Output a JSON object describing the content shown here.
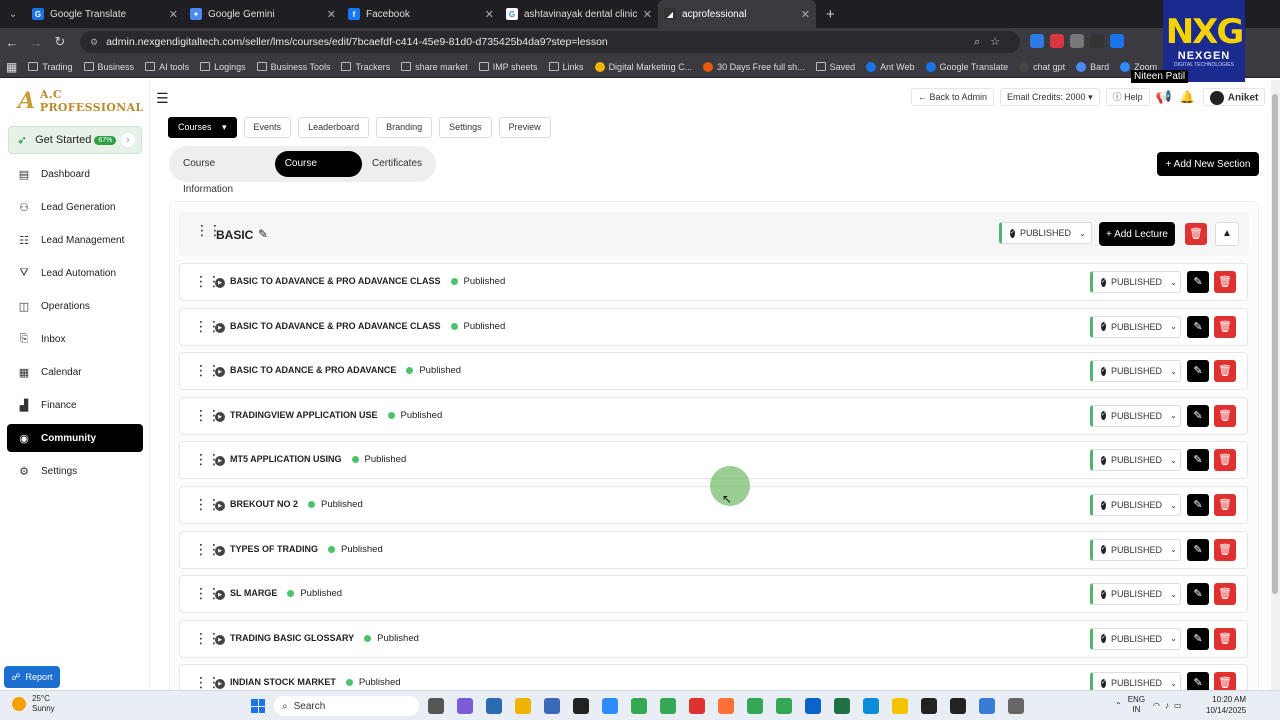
{
  "browser": {
    "tabs": [
      {
        "label": "Google Translate",
        "color": "#1a73e8",
        "glyph": "G"
      },
      {
        "label": "Google Gemini",
        "color": "#4a8af4",
        "glyph": "✦"
      },
      {
        "label": "Facebook",
        "color": "#1877f2",
        "glyph": "f"
      },
      {
        "label": "ashtavinayak dental clinic kolha",
        "color": "#ffffff",
        "glyph": "G"
      },
      {
        "label": "acprofessional",
        "color": "#333333",
        "glyph": "◢",
        "active": true
      }
    ],
    "url": "admin.nexgendigitaltech.com/seller/lms/courses/edit/7bcaefdf-c414-45e9-81d0-d735425b4da9?step=lesson",
    "bookmarks": [
      "Trading",
      "Business",
      "AI tools",
      "Logings",
      "Business Tools",
      "Trackers",
      "share market",
      "IMP sheets",
      "Links",
      "Digital Marketing C...",
      "30 Days Free full sh...",
      "Saved",
      "Ant Web",
      "Google Translate",
      "chat gpt",
      "Bard",
      "Zoom"
    ]
  },
  "overlay": {
    "logo_big": "NXG",
    "logo_name": "NEXGEN",
    "logo_sub": "DIGITAL TECHNOLOGIES",
    "profile_name": "Niteen Patil"
  },
  "sidebar": {
    "brand": "A.C PROFESSIONAL",
    "brand_mark": "A",
    "get_started": {
      "label": "Get Started",
      "percent": "67%"
    },
    "items": [
      {
        "label": "Dashboard",
        "icon": "▤"
      },
      {
        "label": "Lead Generation",
        "icon": "⚇"
      },
      {
        "label": "Lead Management",
        "icon": "☷"
      },
      {
        "label": "Lead Automation",
        "icon": "⛛"
      },
      {
        "label": "Operations",
        "icon": "◫"
      },
      {
        "label": "Inbox",
        "icon": "⎘"
      },
      {
        "label": "Calendar",
        "icon": "▦"
      },
      {
        "label": "Finance",
        "icon": "▟"
      },
      {
        "label": "Community",
        "icon": "◉"
      },
      {
        "label": "Settings",
        "icon": "⚙"
      }
    ],
    "active": "Community",
    "report": "Report"
  },
  "topbar": {
    "back": "← Back to Admin",
    "email_credits": "Email Credits: 2000",
    "help": "Help",
    "user": "Aniket"
  },
  "main": {
    "course_tabs": [
      "Courses",
      "Events",
      "Leaderboard",
      "Branding",
      "Settings",
      "Preview"
    ],
    "content_tabs": [
      "Course Information",
      "Course Content",
      "Certificates"
    ],
    "add_section": "+ Add New Section",
    "section": {
      "name": "BASIC",
      "status": "PUBLISHED",
      "add_lecture": "+ Add Lecture"
    },
    "lectures": [
      {
        "title": "BASIC TO ADAVANCE & PRO ADAVANCE CLASS",
        "badge": "Published",
        "status": "PUBLISHED"
      },
      {
        "title": "BASIC TO ADAVANCE & PRO ADAVANCE CLASS",
        "badge": "Published",
        "status": "PUBLISHED"
      },
      {
        "title": "BASIC TO ADANCE & PRO ADAVANCE",
        "badge": "Published",
        "status": "PUBLISHED"
      },
      {
        "title": "TRADINGVIEW APPLICATION USE",
        "badge": "Published",
        "status": "PUBLISHED"
      },
      {
        "title": "MT5 APPLICATION USING",
        "badge": "Published",
        "status": "PUBLISHED"
      },
      {
        "title": "BREKOUT NO 2",
        "badge": "Published",
        "status": "PUBLISHED"
      },
      {
        "title": "TYPES OF TRADING",
        "badge": "Published",
        "status": "PUBLISHED"
      },
      {
        "title": "SL MARGE",
        "badge": "Published",
        "status": "PUBLISHED"
      },
      {
        "title": "TRADING BASIC GLOSSARY",
        "badge": "Published",
        "status": "PUBLISHED"
      },
      {
        "title": "INDIAN STOCK MARKET",
        "badge": "Published",
        "status": "PUBLISHED"
      }
    ]
  },
  "taskbar": {
    "weather_temp": "25°C",
    "weather_desc": "Sunny",
    "search": "Search",
    "lang": "ENG",
    "region": "IN",
    "time": "10:20 AM",
    "date": "10/14/2025",
    "notif_count": "2"
  }
}
